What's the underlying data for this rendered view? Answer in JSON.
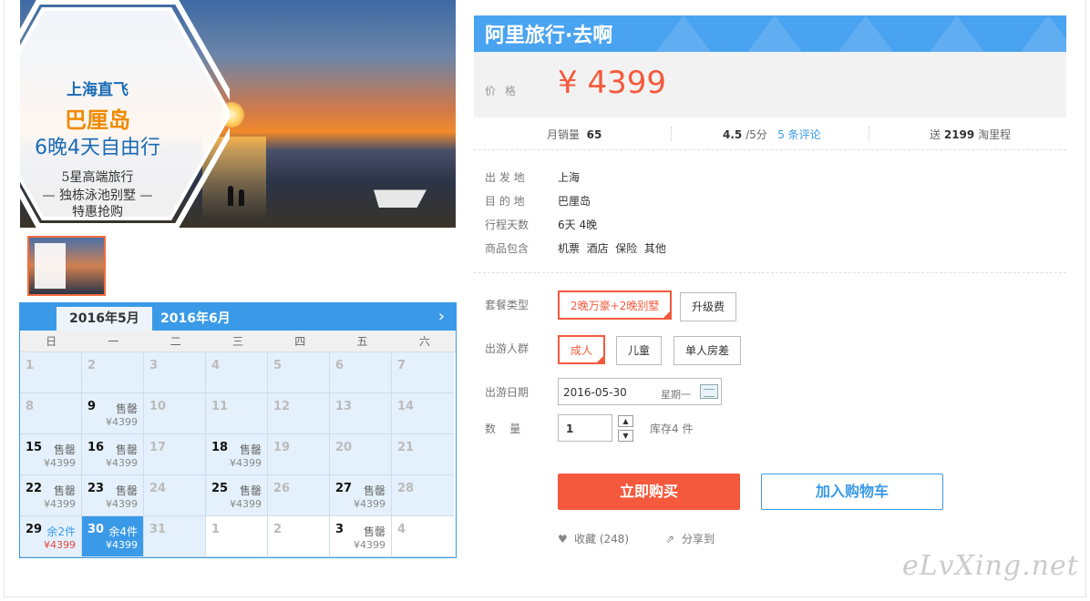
{
  "hero": {
    "line1": "上海直飞",
    "line2": "巴厘岛",
    "line3": "6晚4天自由行",
    "line4": "5星高端旅行",
    "line5": "— 独栋泳池别墅 —",
    "line6": "特惠抢购"
  },
  "calendar": {
    "active_month": "2016年5月",
    "next_month": "2016年6月",
    "next_icon": "chevron-right-icon",
    "weekdays": [
      "日",
      "一",
      "二",
      "三",
      "四",
      "五",
      "六"
    ],
    "cells": [
      {
        "day": "1",
        "status": "",
        "price": ""
      },
      {
        "day": "2",
        "status": "",
        "price": ""
      },
      {
        "day": "3",
        "status": "",
        "price": ""
      },
      {
        "day": "4",
        "status": "",
        "price": ""
      },
      {
        "day": "5",
        "status": "",
        "price": ""
      },
      {
        "day": "6",
        "status": "",
        "price": ""
      },
      {
        "day": "7",
        "status": "",
        "price": ""
      },
      {
        "day": "8",
        "status": "",
        "price": ""
      },
      {
        "day": "9",
        "status": "售罄",
        "price": "¥4399"
      },
      {
        "day": "10",
        "status": "",
        "price": ""
      },
      {
        "day": "11",
        "status": "",
        "price": ""
      },
      {
        "day": "12",
        "status": "",
        "price": ""
      },
      {
        "day": "13",
        "status": "",
        "price": ""
      },
      {
        "day": "14",
        "status": "",
        "price": ""
      },
      {
        "day": "15",
        "status": "售罄",
        "price": "¥4399"
      },
      {
        "day": "16",
        "status": "售罄",
        "price": "¥4399"
      },
      {
        "day": "17",
        "status": "",
        "price": ""
      },
      {
        "day": "18",
        "status": "售罄",
        "price": "¥4399"
      },
      {
        "day": "19",
        "status": "",
        "price": ""
      },
      {
        "day": "20",
        "status": "",
        "price": ""
      },
      {
        "day": "21",
        "status": "",
        "price": ""
      },
      {
        "day": "22",
        "status": "售罄",
        "price": "¥4399"
      },
      {
        "day": "23",
        "status": "售罄",
        "price": "¥4399"
      },
      {
        "day": "24",
        "status": "",
        "price": ""
      },
      {
        "day": "25",
        "status": "售罄",
        "price": "¥4399"
      },
      {
        "day": "26",
        "status": "",
        "price": ""
      },
      {
        "day": "27",
        "status": "售罄",
        "price": "¥4399"
      },
      {
        "day": "28",
        "status": "",
        "price": ""
      },
      {
        "day": "29",
        "status": "余2件",
        "price": "¥4399"
      },
      {
        "day": "30",
        "status": "余4件",
        "price": "¥4399"
      },
      {
        "day": "31",
        "status": "",
        "price": ""
      },
      {
        "day": "1",
        "status": "",
        "price": ""
      },
      {
        "day": "2",
        "status": "",
        "price": ""
      },
      {
        "day": "3",
        "status": "售罄",
        "price": "¥4399"
      },
      {
        "day": "4",
        "status": "",
        "price": ""
      }
    ]
  },
  "product": {
    "brand_title": "阿里旅行·去啊",
    "price_label": "价格",
    "price": "¥ 4399",
    "monthly_sales_label": "月销量",
    "monthly_sales": "65",
    "rating": "4.5",
    "rating_suffix": "/5分",
    "reviews": "5 条评论",
    "points_prefix": "送",
    "points": "2199",
    "points_suffix": "淘里程",
    "info": [
      {
        "k": "出 发 地",
        "v": "上海"
      },
      {
        "k": "目 的 地",
        "v": "巴厘岛"
      },
      {
        "k": "行程天数",
        "v": "6天 4晚"
      },
      {
        "k": "商品包含",
        "v": "机票  酒店  保险  其他"
      }
    ]
  },
  "options": {
    "package_label": "套餐类型",
    "package_selected": "2晚万豪+2晚别墅",
    "package_other": "升级费",
    "people_label": "出游人群",
    "people_adult": "成人",
    "people_child": "儿童",
    "people_single": "单人房差",
    "date_label": "出游日期",
    "date_value": "2016-05-30",
    "date_weekday": "星期一",
    "qty_label": "数    量",
    "qty_value": "1",
    "stock": "库存4 件"
  },
  "actions": {
    "buy": "立即购买",
    "cart": "加入购物车",
    "fav": "收藏 (248)",
    "share": "分享到"
  },
  "watermark": "eLvXing.net",
  "colors": {
    "accent_blue": "#3a9ae8",
    "accent_red": "#f5593d"
  }
}
